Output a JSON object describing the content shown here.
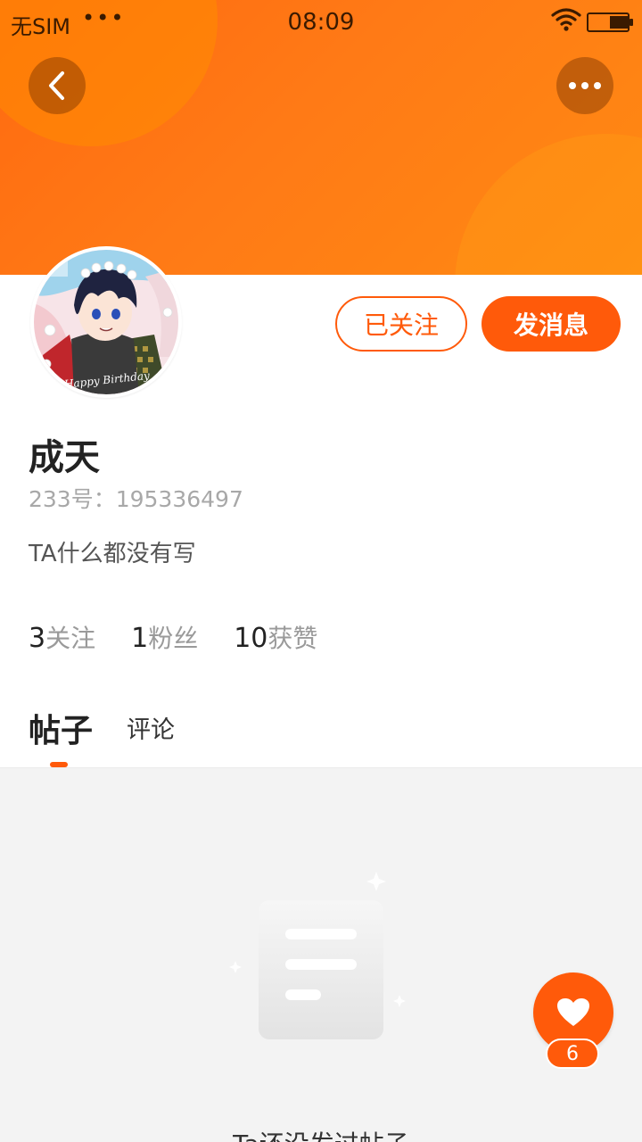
{
  "status_bar": {
    "carrier": "无SIM",
    "dots": "•••",
    "time": "08:09"
  },
  "header": {
    "back_icon": "chevron-left-icon",
    "more_icon": "more-horizontal-icon"
  },
  "profile": {
    "name": "成天",
    "uid_text": "233号：195336497",
    "bio": "TA什么都没有写",
    "avatar_caption": "Happy Birthday"
  },
  "actions": {
    "followed_label": "已关注",
    "message_label": "发消息"
  },
  "stats": [
    {
      "count": "3",
      "label": "关注"
    },
    {
      "count": "1",
      "label": "粉丝"
    },
    {
      "count": "10",
      "label": "获赞"
    }
  ],
  "tabs": [
    {
      "label": "帖子",
      "active": true
    },
    {
      "label": "评论",
      "active": false
    }
  ],
  "empty_state": {
    "text": "Ta还没发过帖子",
    "icon": "document-icon"
  },
  "like_fab": {
    "icon": "heart-icon",
    "count": "6"
  },
  "colors": {
    "accent": "#ff5a0a",
    "banner": "#ff7a16"
  }
}
